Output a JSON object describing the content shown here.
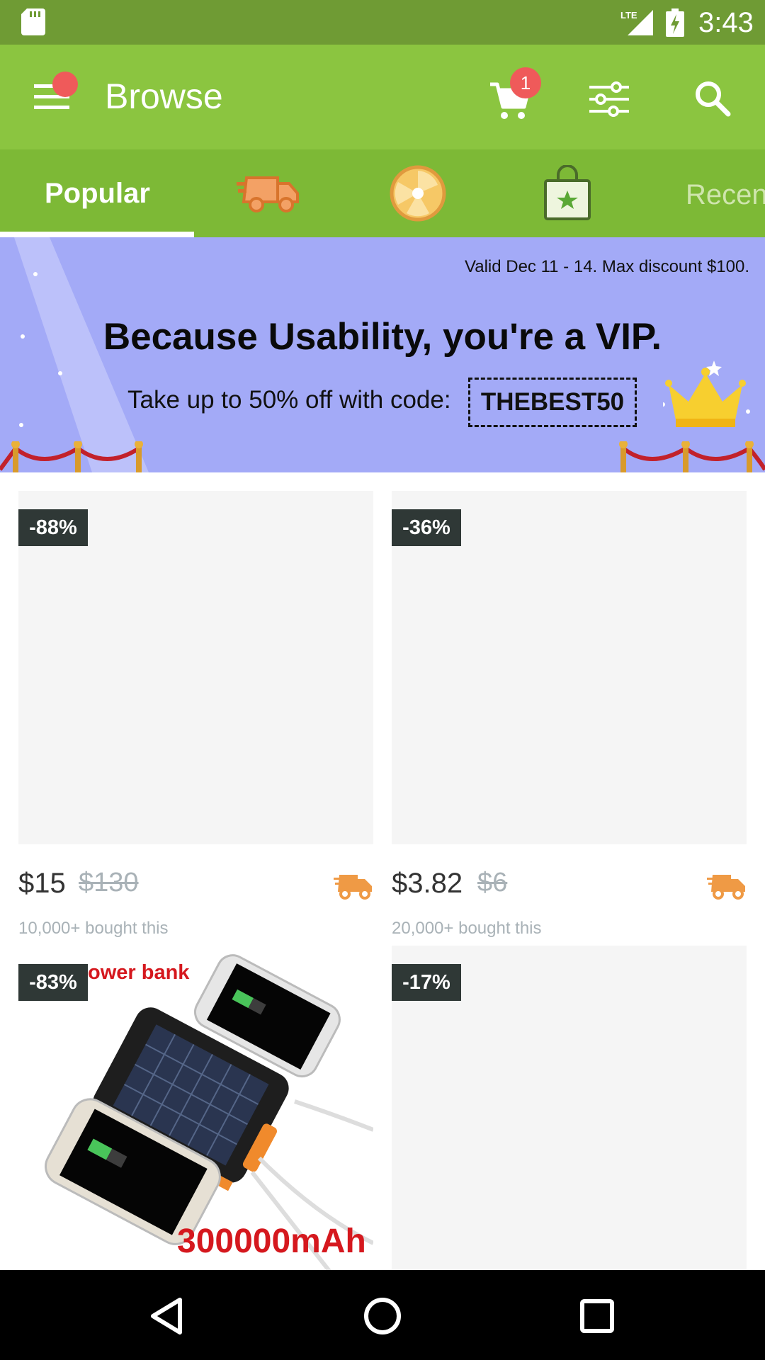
{
  "status_bar": {
    "time": "3:43",
    "network": "LTE",
    "icons": [
      "sd-card-icon",
      "lte-signal-icon",
      "battery-charging-icon"
    ]
  },
  "toolbar": {
    "title": "Browse",
    "cart_count": "1",
    "icons": [
      "menu-icon",
      "cart-icon",
      "filter-icon",
      "search-icon"
    ]
  },
  "tabs": {
    "popular_label": "Popular",
    "recent_label": "Recen",
    "icons": [
      "fast-delivery-icon",
      "spin-wheel-icon",
      "shopping-bag-icon"
    ]
  },
  "banner": {
    "valid_text": "Valid Dec 11 - 14. Max discount $100.",
    "headline": "Because Usability, you're a VIP.",
    "offer_text": "Take up to 50% off with code:",
    "code": "THEBEST50"
  },
  "products": [
    {
      "discount": "-88%",
      "price": "$15",
      "old_price": "$130",
      "bought": "10,000+ bought this"
    },
    {
      "discount": "-36%",
      "price": "$3.82",
      "old_price": "$6",
      "bought": "20,000+ bought this"
    },
    {
      "discount": "-83%",
      "image_title": "ower bank",
      "image_caption": "300000mAh"
    },
    {
      "discount": "-17%"
    }
  ],
  "colors": {
    "status_bar": "#6f9b34",
    "toolbar": "#8bc540",
    "tabs": "#7db936",
    "banner": "#a3aaf7",
    "badge": "#2f3836",
    "notification": "#ef5a5a",
    "shipping_icon": "#ef9a45"
  }
}
